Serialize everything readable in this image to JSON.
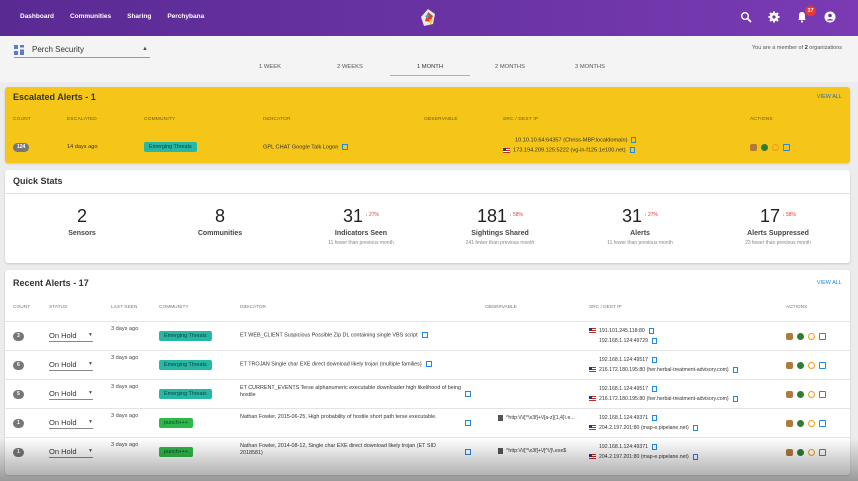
{
  "nav": {
    "links": [
      "Dashboard",
      "Communities",
      "Sharing",
      "Perchybana"
    ],
    "notifications_count": "17",
    "colors": {
      "bar": "#6b34a6",
      "badge": "#e53935"
    }
  },
  "org": {
    "selected": "Perch Security",
    "member_note_prefix": "You are a member of",
    "member_count": "2",
    "member_note_suffix": "organizations"
  },
  "periods": [
    "1 WEEK",
    "2 WEEKS",
    "1 MONTH",
    "2 MONTHS",
    "3 MONTHS"
  ],
  "active_period": "1 MONTH",
  "escalated": {
    "title": "Escalated Alerts - 1",
    "view_all": "VIEW ALL",
    "headers": [
      "COUNT",
      "ESCALATED",
      "COMMUNITY",
      "INDICATOR",
      "OBSERVABLE",
      "SRC / DEST IP",
      "ACTIONS"
    ],
    "row": {
      "count": "124",
      "escalated": "14 days ago",
      "community": "Emerging Threats",
      "indicator": "GPL CHAT Google Talk Logon",
      "src": "10.10.10.64:64357 (Chriss-MBP.localdomain)",
      "dest": "173.194.209.125:5222 (vg-in-f125.1e100.net)"
    }
  },
  "quick_stats": {
    "title": "Quick Stats",
    "stats": [
      {
        "value": "2",
        "label": "Sensors",
        "trend": "",
        "sub": ""
      },
      {
        "value": "8",
        "label": "Communities",
        "trend": "",
        "sub": ""
      },
      {
        "value": "31",
        "label": "Indicators Seen",
        "trend": "27%",
        "sub": "11 fewer than previous month"
      },
      {
        "value": "181",
        "label": "Sightings Shared",
        "trend": "58%",
        "sub": "241 fewer than previous month"
      },
      {
        "value": "31",
        "label": "Alerts",
        "trend": "27%",
        "sub": "11 fewer than previous month"
      },
      {
        "value": "17",
        "label": "Alerts Suppressed",
        "trend": "58%",
        "sub": "23 fewer than previous month"
      }
    ]
  },
  "recent": {
    "title": "Recent Alerts - 17",
    "view_all": "VIEW ALL",
    "headers": [
      "COUNT",
      "STATUS",
      "LAST SEEN",
      "COMMUNITY",
      "INDICATOR",
      "OBSERVABLE",
      "SRC / DEST IP",
      "ACTIONS"
    ],
    "rows": [
      {
        "count": "3",
        "status": "On Hold",
        "last_seen": "3 days ago",
        "community": "Emerging Threats",
        "community_color": "teal",
        "indicator": "ET WEB_CLIENT Suspicious Possible Zip DL containing single VBS script",
        "observable": "",
        "src": "191.101.245.118:80",
        "dest": "192.168.1.124:49729",
        "src_flag_first": true
      },
      {
        "count": "6",
        "status": "On Hold",
        "last_seen": "3 days ago",
        "community": "Emerging Threats",
        "community_color": "teal",
        "indicator": "ET TROJAN Single char EXE direct download likely trojan (multiple families)",
        "observable": "",
        "src": "192.168.1.124:49517",
        "dest": "216.172.180.195:80 (her.herbal-treatment-advisory.com)",
        "src_flag_first": false
      },
      {
        "count": "5",
        "status": "On Hold",
        "last_seen": "3 days ago",
        "community": "Emerging Threats",
        "community_color": "teal",
        "indicator": "ET CURRENT_EVENTS Terse alphanumeric executable downloader high likelihood of being hostile",
        "observable": "",
        "src": "192.168.1.124:49517",
        "dest": "216.172.180.195:80 (her.herbal-treatment-advisory.com)",
        "src_flag_first": false
      },
      {
        "count": "1",
        "status": "On Hold",
        "last_seen": "3 days ago",
        "community": "punch+++",
        "community_color": "green",
        "indicator": "Nathan Fowler, 2015-06-25, High probability of hostile short path terse executable.",
        "observable": "^http:\\/\\/[^\\x3f]+\\/[a-z]{1,4}\\.e...",
        "src": "192.168.1.124:49371",
        "dest": "204.2.197.201:80 (map-e.pipelane.net)",
        "src_flag_first": false
      },
      {
        "count": "1",
        "status": "On Hold",
        "last_seen": "3 days ago",
        "community": "punch+++",
        "community_color": "green",
        "indicator": "Nathan Fowler, 2014-08-12, Single char EXE direct download likely trojan (ET SID 2018581)",
        "observable": "^http:\\/\\/[^\\x3f]+\\/[^\\/]\\.exe$",
        "src": "192.168.1.124:49371",
        "dest": "204.2.197.201:80 (map-e.pipelane.net)",
        "src_flag_first": false
      }
    ]
  },
  "icons": [
    "perch-logo-icon",
    "search-icon",
    "gear-icon",
    "bell-icon",
    "account-icon",
    "grid-icon",
    "external-link-icon",
    "copy-icon",
    "flag-us-icon",
    "bug-icon",
    "check-icon",
    "block-icon",
    "edit-icon",
    "arrow-down-icon"
  ]
}
